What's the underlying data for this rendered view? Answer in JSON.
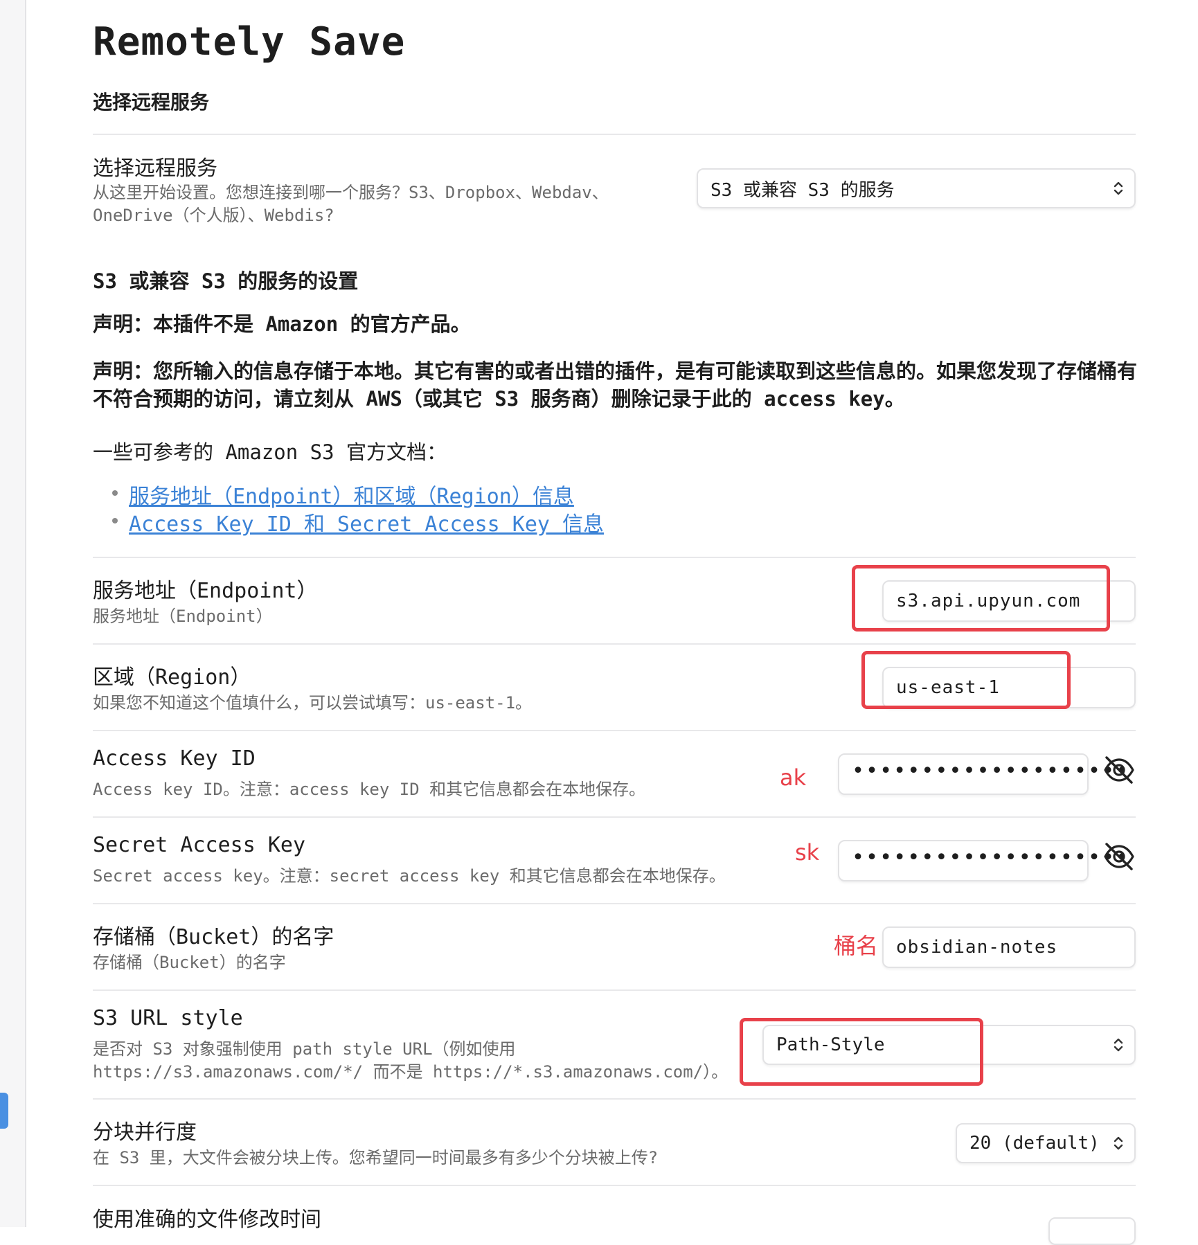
{
  "page": {
    "title": "Remotely Save",
    "section_heading": "选择远程服务"
  },
  "service": {
    "name": "选择远程服务",
    "desc_line1": "从这里开始设置。您想连接到哪一个服务？S3、Dropbox、Webdav、",
    "desc_line2": "OneDrive（个人版）、Webdis?",
    "selected": "S3 或兼容 S3 的服务"
  },
  "s3_section": {
    "heading": "S3 或兼容 S3 的服务的设置",
    "notice1": "声明：本插件不是 Amazon 的官方产品。",
    "notice2": "声明：您所输入的信息存储于本地。其它有害的或者出错的插件，是有可能读取到这些信息的。如果您发现了存储桶有不符合预期的访问，请立刻从 AWS（或其它 S3 服务商）删除记录于此的 access key。",
    "docs_intro": "一些可参考的 Amazon S3 官方文档：",
    "docs": [
      "服务地址（Endpoint）和区域（Region）信息",
      "Access Key ID 和 Secret Access Key 信息"
    ]
  },
  "endpoint": {
    "name": "服务地址（Endpoint）",
    "desc": "服务地址（Endpoint）",
    "value": "s3.api.upyun.com"
  },
  "region": {
    "name": "区域（Region）",
    "desc": "如果您不知道这个值填什么，可以尝试填写：us-east-1。",
    "value": "us-east-1"
  },
  "access_key": {
    "name": "Access Key ID",
    "desc": "Access key ID。注意：access key ID 和其它信息都会在本地保存。",
    "masked": "••••••••••••••••••••",
    "annotation": "ak"
  },
  "secret_key": {
    "name": "Secret Access Key",
    "desc": "Secret access key。注意：secret access key 和其它信息都会在本地保存。",
    "masked": "••••••••••••••••••••",
    "annotation": "sk"
  },
  "bucket": {
    "name": "存储桶（Bucket）的名字",
    "desc": "存储桶（Bucket）的名字",
    "value": "obsidian-notes",
    "annotation": "桶名"
  },
  "url_style": {
    "name": "S3 URL style",
    "desc_line1": "是否对 S3 对象强制使用 path style URL（例如使用",
    "desc_line2": "https://s3.amazonaws.com/*/ 而不是 https://*.s3.amazonaws.com/）。",
    "selected": "Path-Style"
  },
  "parallelism": {
    "name": "分块并行度",
    "desc": "在 S3 里，大文件会被分块上传。您希望同一时间最多有多少个分块被上传?",
    "selected": "20 (default)"
  },
  "mtime": {
    "name": "使用准确的文件修改时间"
  },
  "colors": {
    "annotation_red": "#e8414a",
    "link_blue": "#3b82d6",
    "accent": "#4a90e2"
  },
  "icons": [
    "eye-off-icon",
    "chevron-updown-icon"
  ]
}
